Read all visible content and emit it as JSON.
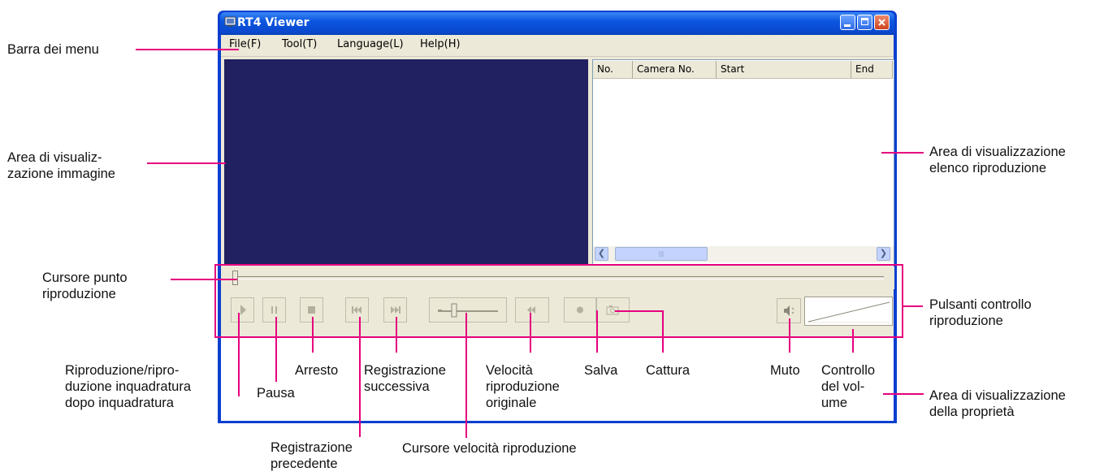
{
  "window": {
    "title": "RT4 Viewer",
    "menu": [
      "File(F)",
      "Tool(T)",
      "Language(L)",
      "Help(H)"
    ],
    "list_columns": [
      "No.",
      "Camera No.",
      "Start",
      "End"
    ]
  },
  "callouts": {
    "menu_bar": "Barra dei menu",
    "image_area": [
      "Area di visualiz-",
      "zazione immagine"
    ],
    "playlist_area": [
      "Area di visualizzazione",
      "elenco riproduzione"
    ],
    "seek_slider": [
      "Cursore punto",
      "riproduzione"
    ],
    "controls": [
      "Pulsanti controllo",
      "riproduzione"
    ],
    "play": [
      "Riproduzione/ripro-",
      "duzione inquadratura",
      "dopo inquadratura"
    ],
    "pause": "Pausa",
    "stop": "Arresto",
    "next": [
      "Registrazione",
      "successiva"
    ],
    "original_speed": [
      "Velocità",
      "riproduzione",
      "originale"
    ],
    "save": "Salva",
    "capture": "Cattura",
    "mute": "Muto",
    "volume": [
      "Controllo",
      "del vol-",
      "ume"
    ],
    "properties": [
      "Area di visualizzazione",
      "della proprietà"
    ],
    "previous": [
      "Registrazione",
      "precedente"
    ],
    "speed_slider": "Cursore velocità riproduzione"
  },
  "colors": {
    "leader": "#e6007e",
    "window_frame": "#0a3fd0",
    "image_bg": "#212060",
    "panel": "#ece9d8"
  }
}
